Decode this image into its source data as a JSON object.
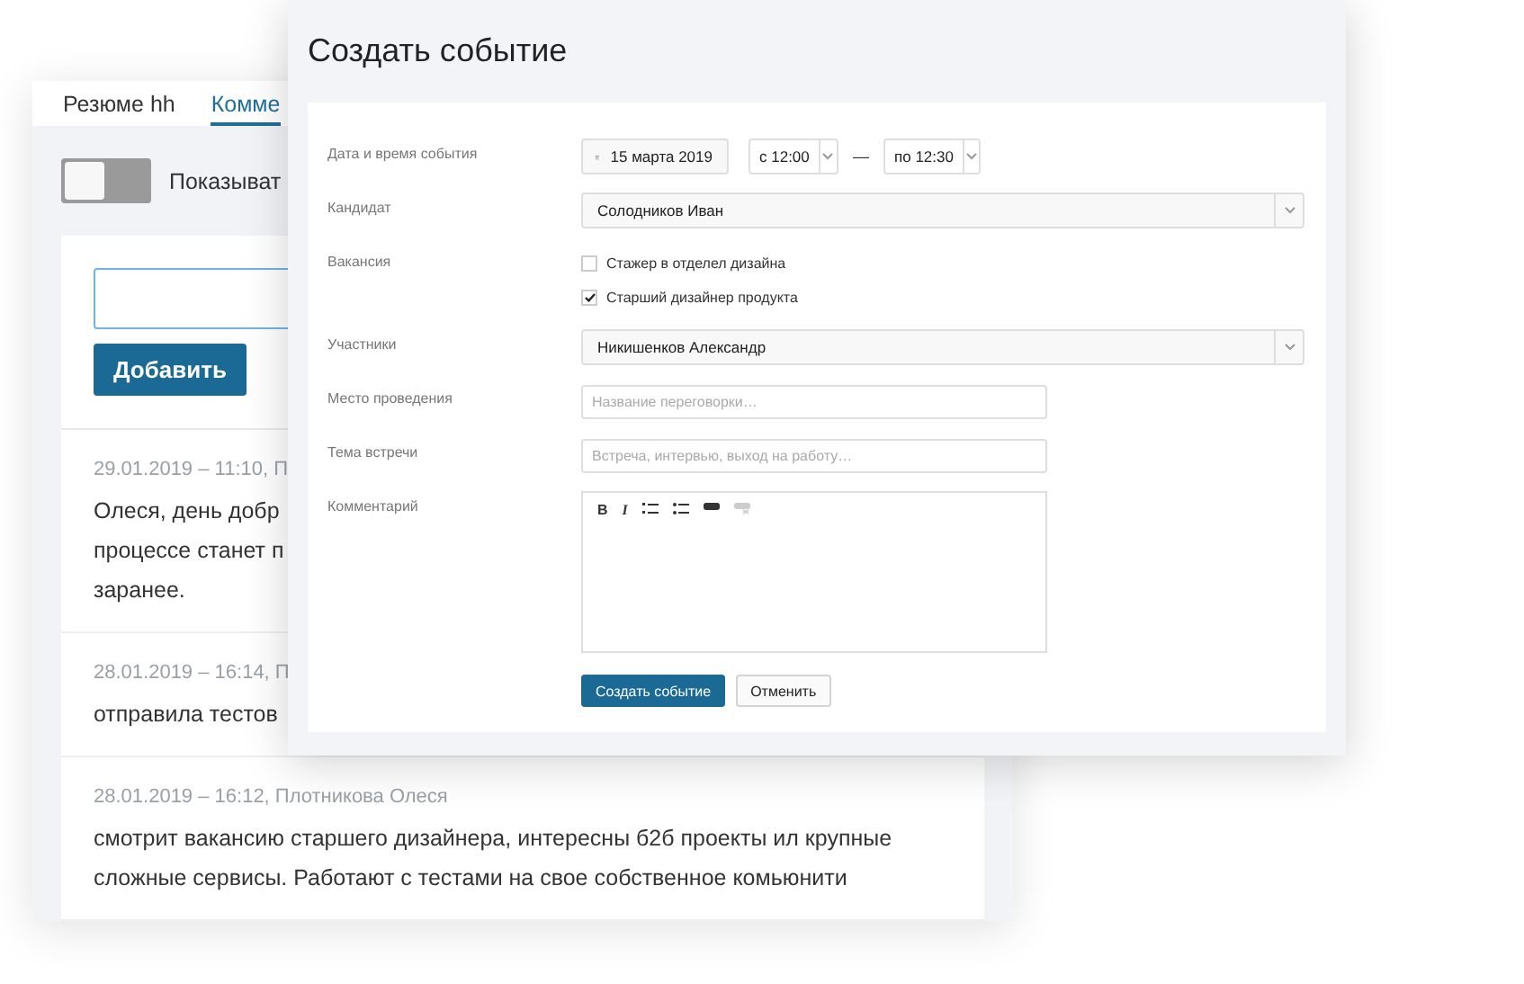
{
  "background_panel": {
    "tabs": [
      {
        "label": "Резюме hh",
        "selected": false
      },
      {
        "label": "Комме",
        "selected": true
      }
    ],
    "toggle": {
      "label": "Показыват",
      "on": false
    },
    "add_button": "Добавить",
    "comments": [
      {
        "meta": "29.01.2019 – 11:10, П",
        "lines": [
          "Олеся, день добр",
          "процессе станет п",
          "заранее."
        ]
      },
      {
        "meta": "28.01.2019 – 16:14, П",
        "lines": [
          "отправила тестов"
        ]
      },
      {
        "meta": "28.01.2019 – 16:12, Плотникова Олеся",
        "lines": [
          "смотрит вакансию старшего дизайнера, интересны б2б проекты ил крупные",
          "сложные сервисы. Работают с тестами на свое собственное комьюнити"
        ]
      }
    ]
  },
  "dialog": {
    "title": "Создать событие",
    "fields": [
      {
        "kind": "datetime",
        "label": "Дата и время события",
        "date": "15 марта 2019",
        "from": "с 12:00",
        "dash": "—",
        "to": "по 12:30"
      },
      {
        "kind": "select",
        "label": "Кандидат",
        "value": "Солодников Иван"
      },
      {
        "kind": "checkboxes",
        "label": "Вакансия",
        "options": [
          {
            "label": "Стажер в отделел дизайна",
            "checked": false
          },
          {
            "label": "Старший дизайнер продукта",
            "checked": true
          }
        ]
      },
      {
        "kind": "select",
        "label": "Участники",
        "value": "Никишенков Александр"
      },
      {
        "kind": "input",
        "label": "Место проведения",
        "placeholder": "Название переговорки…"
      },
      {
        "kind": "input",
        "label": "Тема встречи",
        "placeholder": "Встреча, интервью, выход на работу…"
      },
      {
        "kind": "editor",
        "label": "Комментарий",
        "toolbar": [
          {
            "kind": "bold",
            "label": "B",
            "disabled": false
          },
          {
            "kind": "italic",
            "label": "I",
            "disabled": false
          },
          {
            "kind": "ordered-list",
            "disabled": false
          },
          {
            "kind": "bullet-list",
            "disabled": false
          },
          {
            "kind": "link",
            "disabled": false
          },
          {
            "kind": "unlink",
            "disabled": true
          }
        ]
      }
    ],
    "buttons": [
      {
        "kind": "primary",
        "label": "Создать событие"
      },
      {
        "kind": "secondary",
        "label": "Отменить"
      }
    ]
  }
}
